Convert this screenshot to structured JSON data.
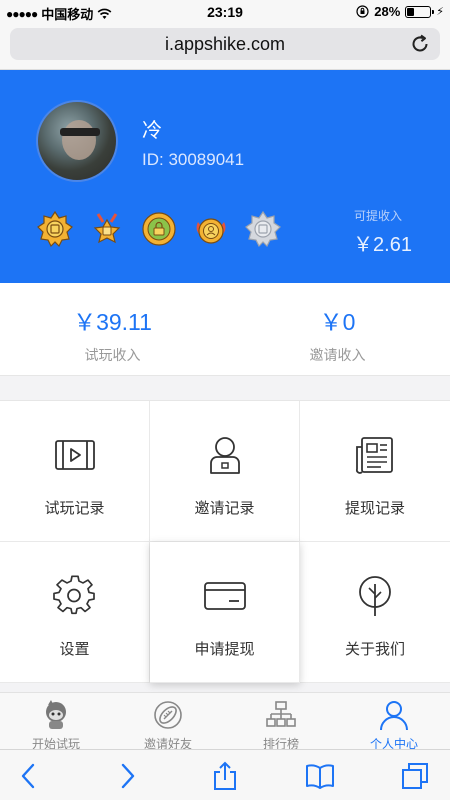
{
  "status_bar": {
    "carrier": "中国移动",
    "time": "23:19",
    "battery": "28%"
  },
  "browser": {
    "url": "i.appshike.com"
  },
  "profile": {
    "name": "冷",
    "id_text": "ID: 30089041",
    "badges": [
      "badge-1",
      "badge-2",
      "badge-3",
      "badge-4",
      "badge-5"
    ],
    "withdrawable_label": "可提收入",
    "withdrawable_value": "￥2.61"
  },
  "income": [
    {
      "value": "￥39.11",
      "label": "试玩收入"
    },
    {
      "value": "￥0",
      "label": "邀请收入"
    }
  ],
  "menu": [
    {
      "label": "试玩记录",
      "icon": "video-icon"
    },
    {
      "label": "邀请记录",
      "icon": "person-icon"
    },
    {
      "label": "提现记录",
      "icon": "newspaper-icon"
    },
    {
      "label": "设置",
      "icon": "gear-icon"
    },
    {
      "label": "申请提现",
      "icon": "card-icon"
    },
    {
      "label": "关于我们",
      "icon": "tree-icon"
    }
  ],
  "tabs": [
    {
      "label": "开始试玩",
      "icon": "mascot-icon",
      "active": false
    },
    {
      "label": "邀请好友",
      "icon": "football-icon",
      "active": false
    },
    {
      "label": "排行榜",
      "icon": "hierarchy-icon",
      "active": false
    },
    {
      "label": "个人中心",
      "icon": "user-icon",
      "active": true
    }
  ],
  "colors": {
    "primary": "#1d74f5",
    "muted": "#999999"
  }
}
